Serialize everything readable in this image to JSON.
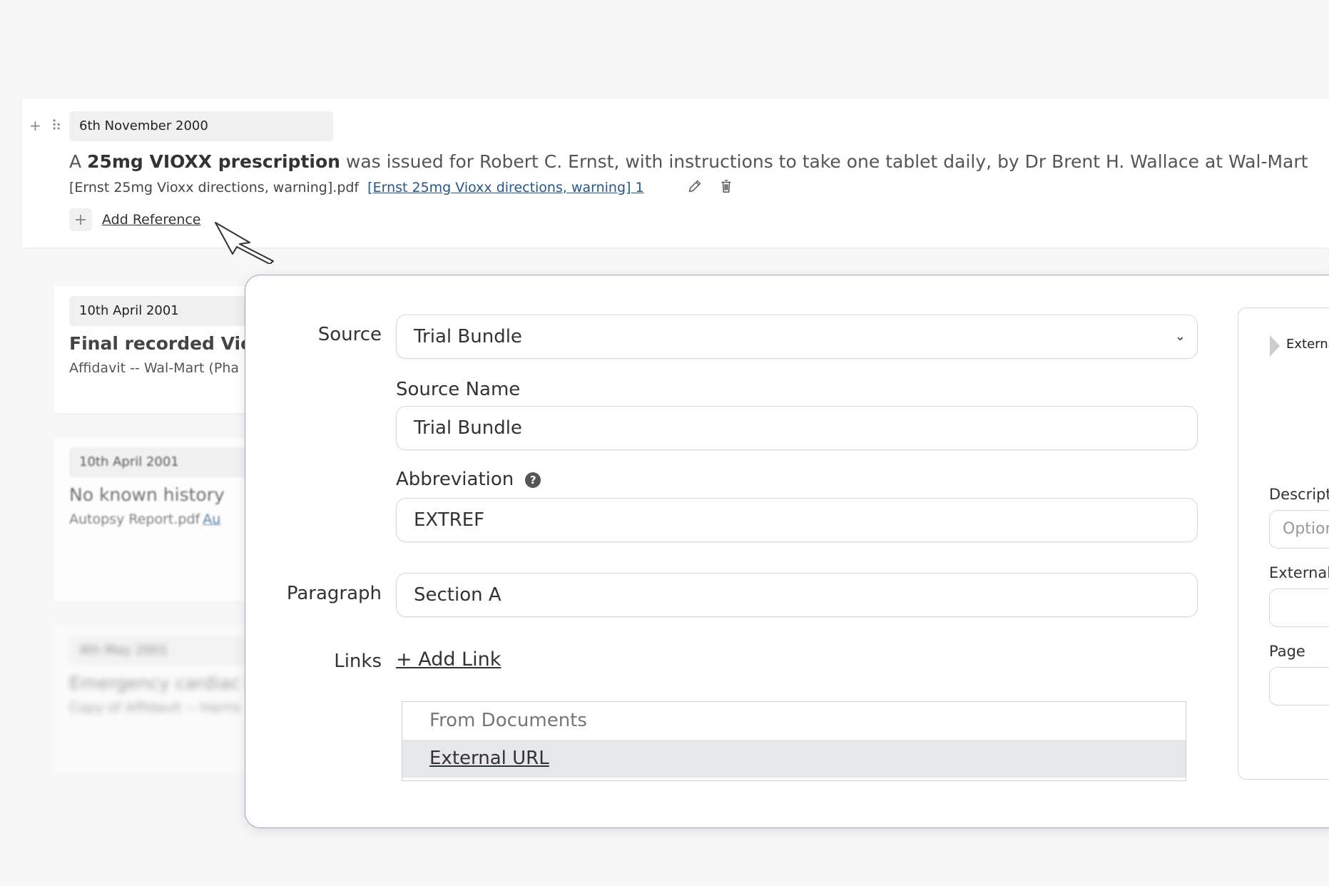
{
  "entries": {
    "main": {
      "date": "6th November 2000",
      "text_prefix": "A ",
      "text_bold": "25mg VIOXX prescription",
      "text_rest": " was issued for Robert C. Ernst, with instructions to take one tablet daily, by Dr Brent H. Wallace at Wal-Mart",
      "ref_filename": "[Ernst 25mg Vioxx directions, warning].pdf",
      "ref_link": "[Ernst 25mg Vioxx directions, warning] 1",
      "add_reference_label": "Add Reference",
      "add_icon": "+",
      "drag_icon": "⠷"
    },
    "second": {
      "date": "10th April 2001",
      "title": "Final recorded Vioxx",
      "subtitle": "Affidavit -- Wal-Mart (Pha"
    },
    "third": {
      "date": "10th April 2001",
      "title": "No known history",
      "subtitle": "Autopsy Report.pdf",
      "link": "Au"
    },
    "fourth": {
      "date": "4th May 2001",
      "title": "Emergency cardiac t",
      "subtitle": "Copy of Affidavit -- Harris"
    }
  },
  "modal": {
    "source_label": "Source",
    "source_value": "Trial Bundle",
    "source_name_label": "Source Name",
    "source_name_value": "Trial Bundle",
    "abbreviation_label": "Abbreviation",
    "abbreviation_value": "EXTREF",
    "paragraph_label": "Paragraph",
    "paragraph_value": "Section A",
    "links_label": "Links",
    "add_link_label": "+ Add Link",
    "dropdown_header": "From Documents",
    "dropdown_option": "External URL"
  },
  "side_panel": {
    "toggle_label": "Externa",
    "description_label": "Descript",
    "description_placeholder": "Option",
    "external_label": "External",
    "page_label": "Page"
  }
}
